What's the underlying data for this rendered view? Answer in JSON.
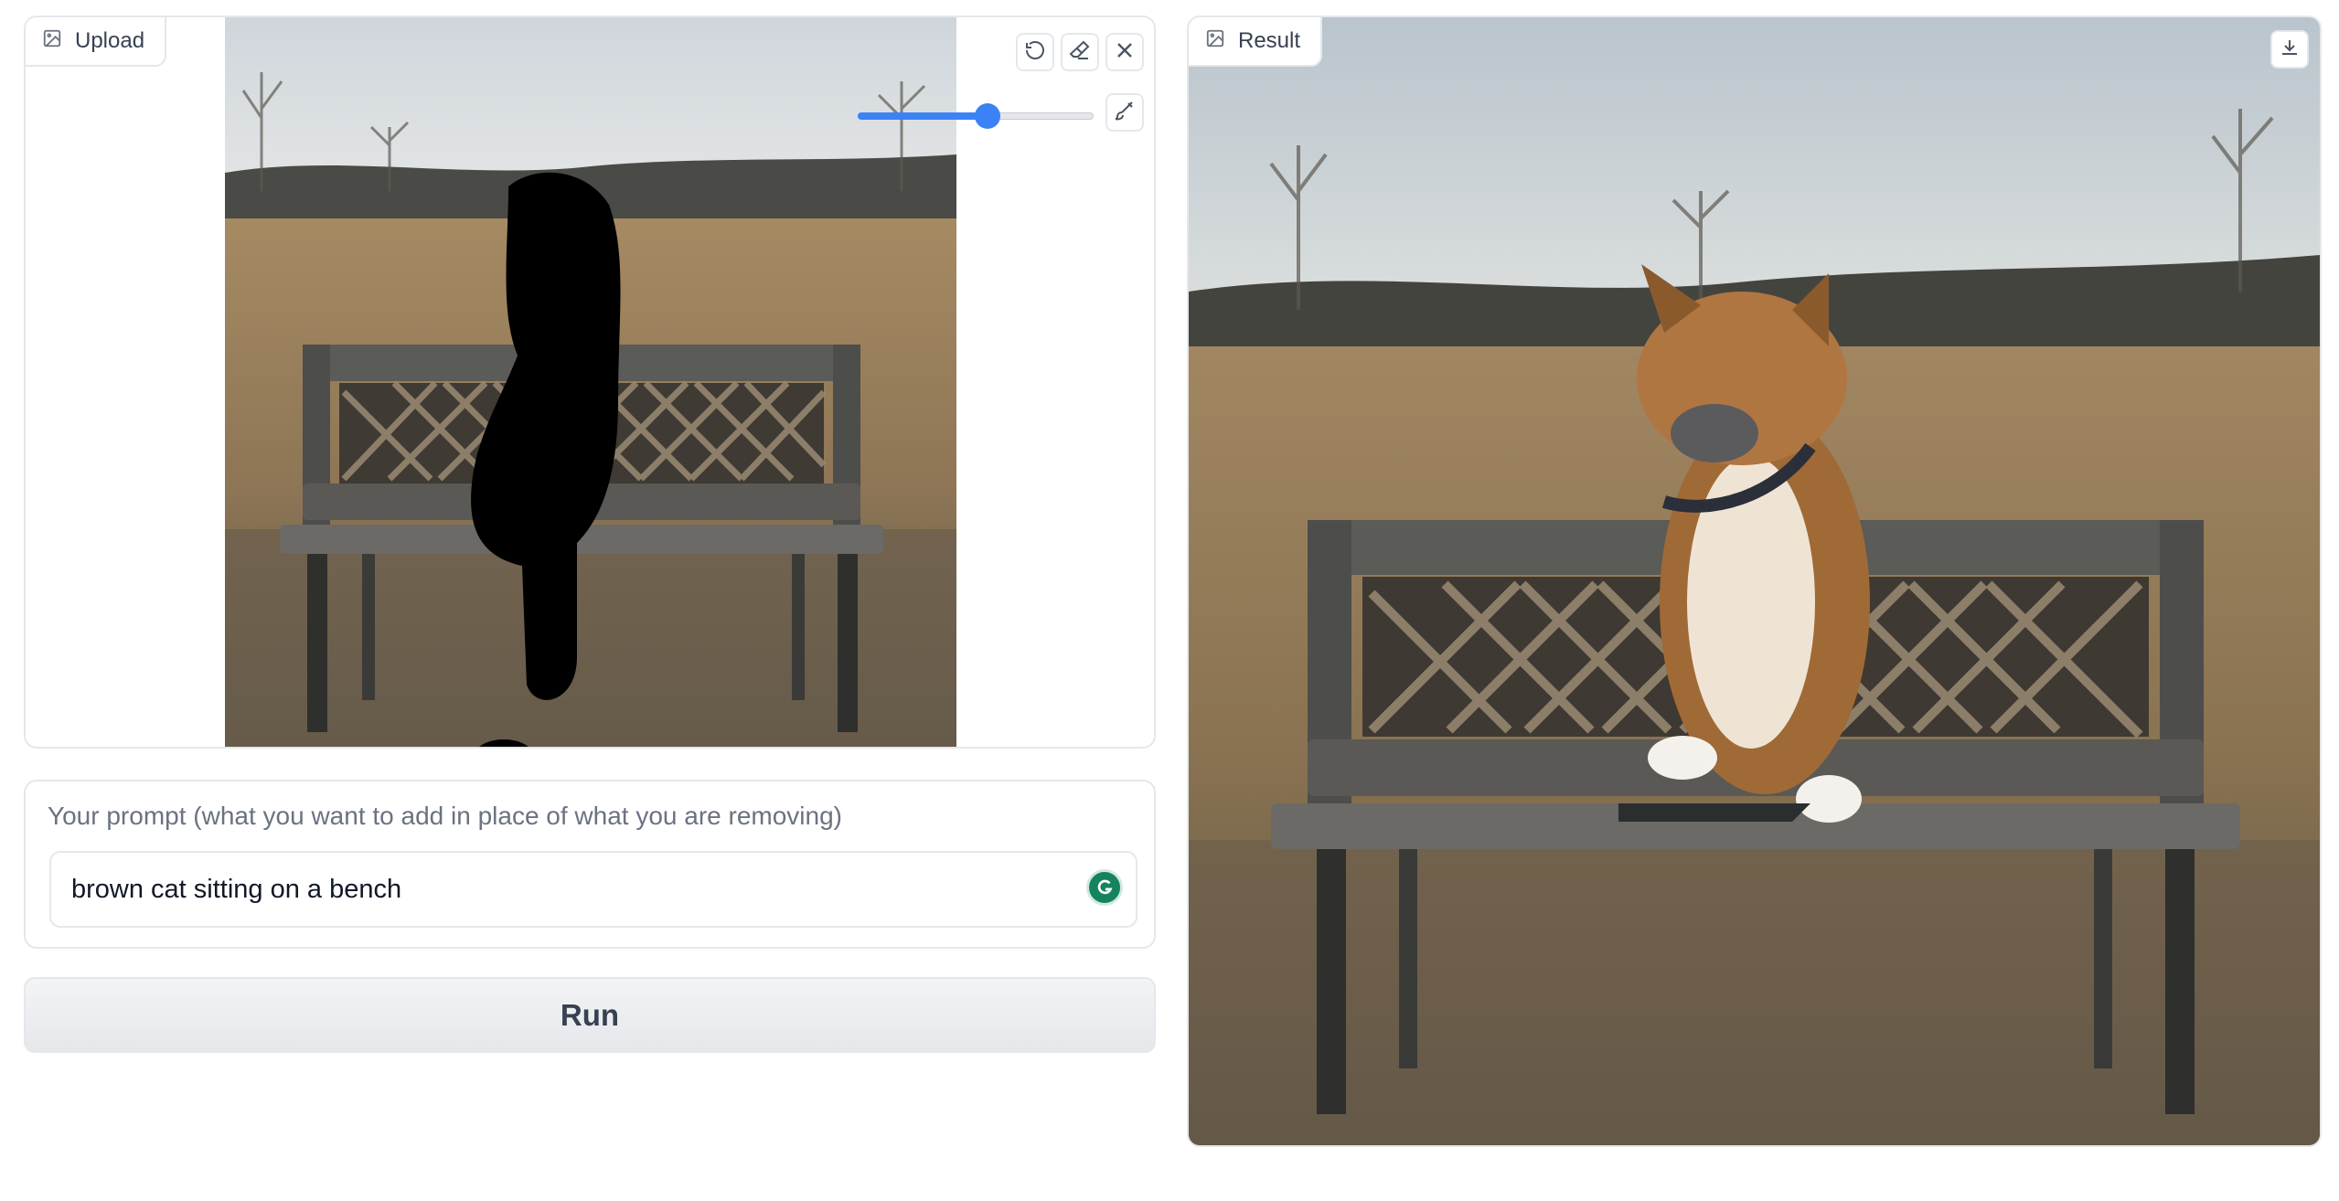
{
  "upload": {
    "label": "Upload",
    "label_icon": "image-icon",
    "tools": [
      "undo-icon",
      "eraser-icon",
      "close-icon",
      "brush-icon"
    ],
    "brush_size_fraction": 0.55
  },
  "prompt": {
    "label": "Your prompt (what you want to add in place of what you are removing)",
    "value": "brown cat sitting on a bench",
    "assistant_icon": "grammarly-icon"
  },
  "run_button": {
    "label": "Run"
  },
  "result": {
    "label": "Result",
    "label_icon": "image-icon",
    "download_icon": "download-icon"
  },
  "colors": {
    "accent": "#3b82f6",
    "border": "#e5e7eb",
    "grammarly": "#15835f"
  }
}
